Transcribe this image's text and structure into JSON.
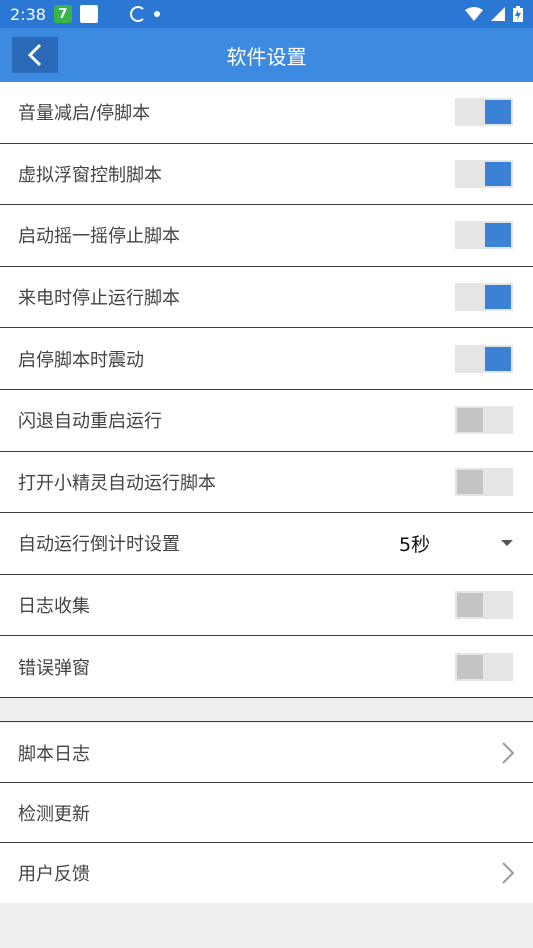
{
  "status_bar": {
    "time": "2:38",
    "badge": "7"
  },
  "header": {
    "title": "软件设置"
  },
  "settings": [
    {
      "label": "音量减启/停脚本",
      "state": "on"
    },
    {
      "label": "虚拟浮窗控制脚本",
      "state": "on"
    },
    {
      "label": "启动摇一摇停止脚本",
      "state": "on"
    },
    {
      "label": "来电时停止运行脚本",
      "state": "on"
    },
    {
      "label": "启停脚本时震动",
      "state": "on"
    },
    {
      "label": "闪退自动重启运行",
      "state": "off"
    },
    {
      "label": "打开小精灵自动运行脚本",
      "state": "off"
    },
    {
      "label": "自动运行倒计时设置",
      "value": "5秒"
    },
    {
      "label": "日志收集",
      "state": "off"
    },
    {
      "label": "错误弹窗",
      "state": "off"
    }
  ],
  "links": [
    {
      "label": "脚本日志",
      "chevron": true
    },
    {
      "label": "检测更新",
      "chevron": false
    },
    {
      "label": "用户反馈",
      "chevron": true
    }
  ],
  "colors": {
    "status_bar": "#2a77d4",
    "header": "#3d8be0",
    "toggle_on": "#3b82d6",
    "toggle_off": "#c4c4c4"
  }
}
